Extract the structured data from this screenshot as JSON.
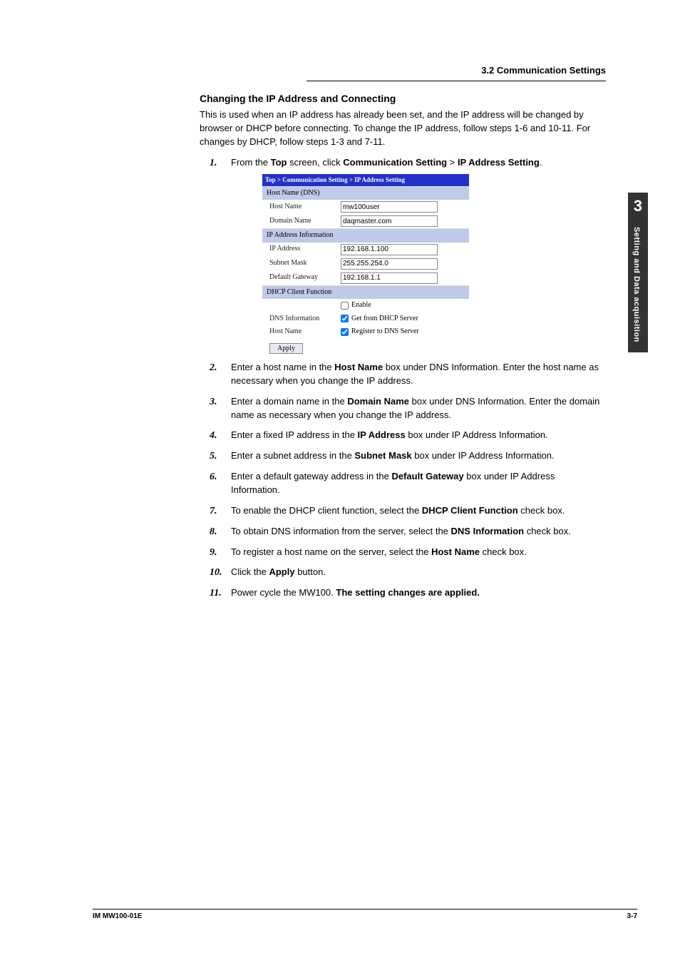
{
  "header": {
    "section_title": "3.2  Communication Settings"
  },
  "sideTab": {
    "chapter": "3",
    "label": "Setting and Data acquisition"
  },
  "subheading": "Changing the IP Address and Connecting",
  "intro": "This is used when an IP address has already been set, and the IP address will be changed by browser or DHCP before connecting. To change the IP address, follow steps 1-6 and 10-11. For changes by DHCP, follow steps 1-3 and 7-11.",
  "step1": {
    "pre": "From the ",
    "b1": "Top",
    "mid1": " screen, click ",
    "b2": "Communication Setting",
    "mid2": " > ",
    "b3": "IP Address Setting",
    "post": "."
  },
  "screenshot": {
    "breadcrumb": "Top > Communication Setting > IP Address Setting",
    "sec1": "Host Name (DNS)",
    "hostNameLabel": "Host Name",
    "hostNameValue": "mw100user",
    "domainNameLabel": "Domain Name",
    "domainNameValue": "daqmaster.com",
    "sec2": "IP Address Information",
    "ipLabel": "IP Address",
    "ipValue": "192.168.1.100",
    "subnetLabel": "Subnet Mask",
    "subnetValue": "255.255.254.0",
    "gatewayLabel": "Default Gateway",
    "gatewayValue": "192.168.1.1",
    "sec3": "DHCP Client Function",
    "enableLabel": "Enable",
    "dnsInfoLabel": "DNS Information",
    "dnsInfoChk": "Get from DHCP Server",
    "hostName2Label": "Host Name",
    "hostName2Chk": "Register to DNS Server",
    "applyBtn": "Apply"
  },
  "steps": {
    "s2a": "Enter a host name in the ",
    "s2b": "Host Name",
    "s2c": " box under DNS Information. Enter the host name as necessary when you change the IP address.",
    "s3a": "Enter a domain name in the ",
    "s3b": "Domain Name",
    "s3c": " box under DNS Information. Enter the domain name as necessary when you change the IP address.",
    "s4a": "Enter a fixed IP address in the ",
    "s4b": "IP Address",
    "s4c": " box under IP Address Information.",
    "s5a": "Enter a subnet address in the ",
    "s5b": "Subnet Mask",
    "s5c": " box under IP Address Information.",
    "s6a": "Enter a default gateway address in the ",
    "s6b": "Default Gateway",
    "s6c": " box under IP Address Information.",
    "s7a": "To enable the DHCP client function, select the ",
    "s7b": "DHCP Client Function",
    "s7c": " check box.",
    "s8a": "To obtain DNS information from the server, select the ",
    "s8b": "DNS Information",
    "s8c": " check box.",
    "s9a": "To register a host name on the server, select the ",
    "s9b": "Host Name",
    "s9c": " check box.",
    "s10a": "Click the ",
    "s10b": "Apply",
    "s10c": " button.",
    "s11a": "Power cycle the MW100. ",
    "s11b": "The setting changes are applied."
  },
  "nums": {
    "n1": "1.",
    "n2": "2.",
    "n3": "3.",
    "n4": "4.",
    "n5": "5.",
    "n6": "6.",
    "n7": "7.",
    "n8": "8.",
    "n9": "9.",
    "n10": "10.",
    "n11": "11."
  },
  "footer": {
    "left": "IM MW100-01E",
    "right": "3-7"
  }
}
